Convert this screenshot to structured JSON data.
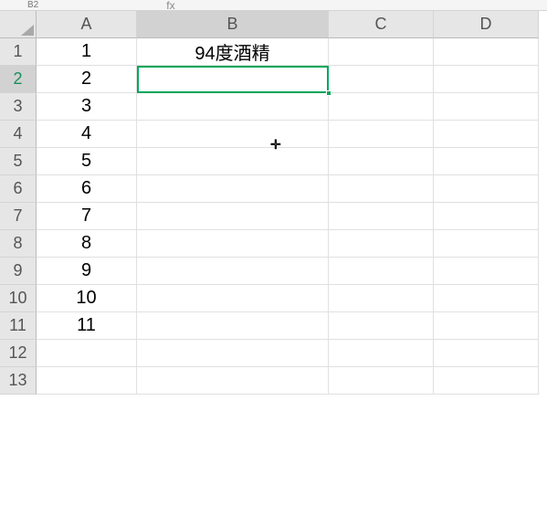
{
  "namebox": "B2",
  "fx_hint": "fx",
  "columns": [
    "A",
    "B",
    "C",
    "D"
  ],
  "rows": [
    "1",
    "2",
    "3",
    "4",
    "5",
    "6",
    "7",
    "8",
    "9",
    "10",
    "11",
    "12",
    "13"
  ],
  "active_col_index": 1,
  "active_row_index": 1,
  "cells": {
    "A1": "1",
    "A2": "2",
    "A3": "3",
    "A4": "4",
    "A5": "5",
    "A6": "6",
    "A7": "7",
    "A8": "8",
    "A9": "9",
    "A10": "10",
    "A11": "11",
    "B1": "94度酒精"
  },
  "selection": {
    "col": "B",
    "row": 2
  },
  "chart_data": null
}
